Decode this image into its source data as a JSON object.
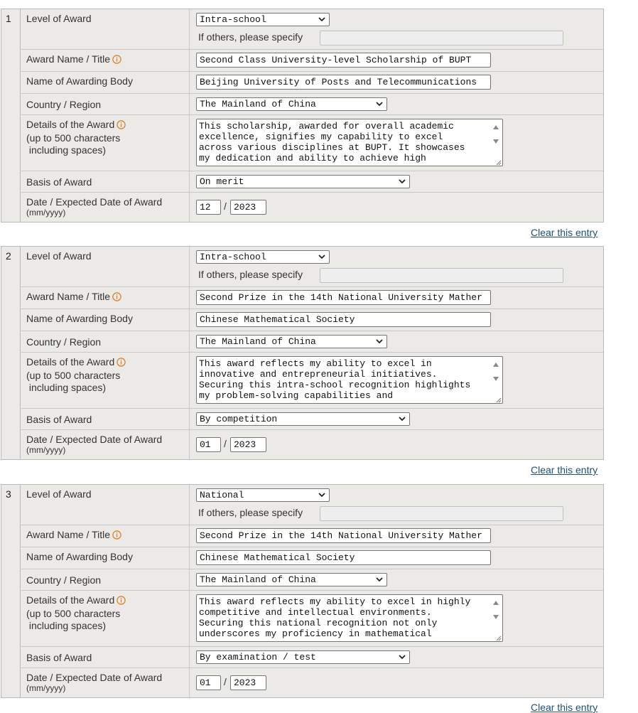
{
  "labels": {
    "level": "Level of Award",
    "others": "If others, please specify",
    "award_name": "Award Name / Title",
    "awarding_body": "Name of Awarding Body",
    "country": "Country / Region",
    "details": "Details of the Award",
    "details_sub1": "(up to 500 characters",
    "details_sub2": " including spaces)",
    "basis": "Basis of Award",
    "date": "Date / Expected Date of Award",
    "date_format": "(mm/yyyy)",
    "date_sep": "/",
    "clear": "Clear this entry"
  },
  "icons": {
    "info": "info-circle-icon",
    "dropdown": "chevron-down-icon",
    "resize": "resize-grip-icon"
  },
  "colors": {
    "info": "#e07b1f",
    "link": "#1f4f74",
    "panel": "#ebeae6"
  },
  "entries": [
    {
      "number": "1",
      "level": "Intra-school",
      "others_value": "",
      "award_name": "Second Class University-level Scholarship of BUPT",
      "awarding_body": "Beijing University of Posts and Telecommunications",
      "country": "The Mainland of China",
      "details": "This scholarship, awarded for overall academic\nexcellence, signifies my capability to excel\nacross various disciplines at BUPT. It showcases\nmy dedication and ability to achieve high",
      "basis": "On merit",
      "month": "12",
      "year": "2023"
    },
    {
      "number": "2",
      "level": "Intra-school",
      "others_value": "",
      "award_name": "Second Prize in the 14th National University Mather",
      "awarding_body": "Chinese Mathematical Society",
      "country": "The Mainland of China",
      "details": "This award reflects my ability to excel in\ninnovative and entrepreneurial initiatives.\nSecuring this intra-school recognition highlights\nmy problem-solving capabilities and",
      "basis": "By competition",
      "month": "01",
      "year": "2023"
    },
    {
      "number": "3",
      "level": "National",
      "others_value": "",
      "award_name": "Second Prize in the 14th National University Mather",
      "awarding_body": "Chinese Mathematical Society",
      "country": "The Mainland of China",
      "details": "This award reflects my ability to excel in highly\ncompetitive and intellectual environments.\nSecuring this national recognition not only\nunderscores my proficiency in mathematical",
      "basis": "By examination / test",
      "month": "01",
      "year": "2023"
    }
  ]
}
